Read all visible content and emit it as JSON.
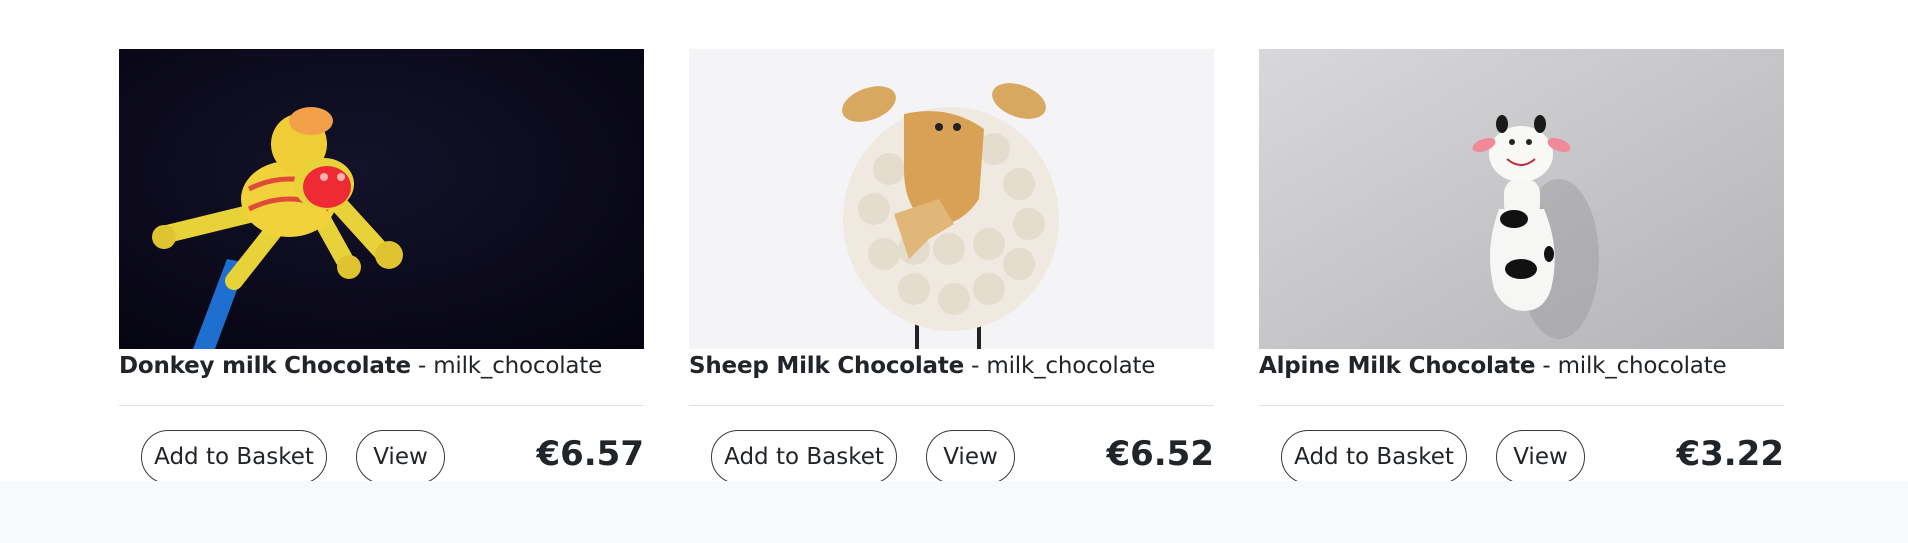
{
  "products": [
    {
      "name": "Donkey milk Chocolate",
      "separator": " - ",
      "category": "milk_chocolate",
      "add_label": "Add to Basket",
      "view_label": "View",
      "price": "€6.57",
      "image_icon": "donkey-toy-photo"
    },
    {
      "name": "Sheep Milk Chocolate",
      "separator": " - ",
      "category": "milk_chocolate",
      "add_label": "Add to Basket",
      "view_label": "View",
      "price": "€6.52",
      "image_icon": "sheep-toy-photo"
    },
    {
      "name": "Alpine Milk Chocolate",
      "separator": " - ",
      "category": "milk_chocolate",
      "add_label": "Add to Basket",
      "view_label": "View",
      "price": "€3.22",
      "image_icon": "cow-toy-photo"
    }
  ],
  "colors": {
    "text": "#212529",
    "divider": "#dee2e6",
    "button_border": "#343a40",
    "footer_background": "#f8f9fa"
  }
}
